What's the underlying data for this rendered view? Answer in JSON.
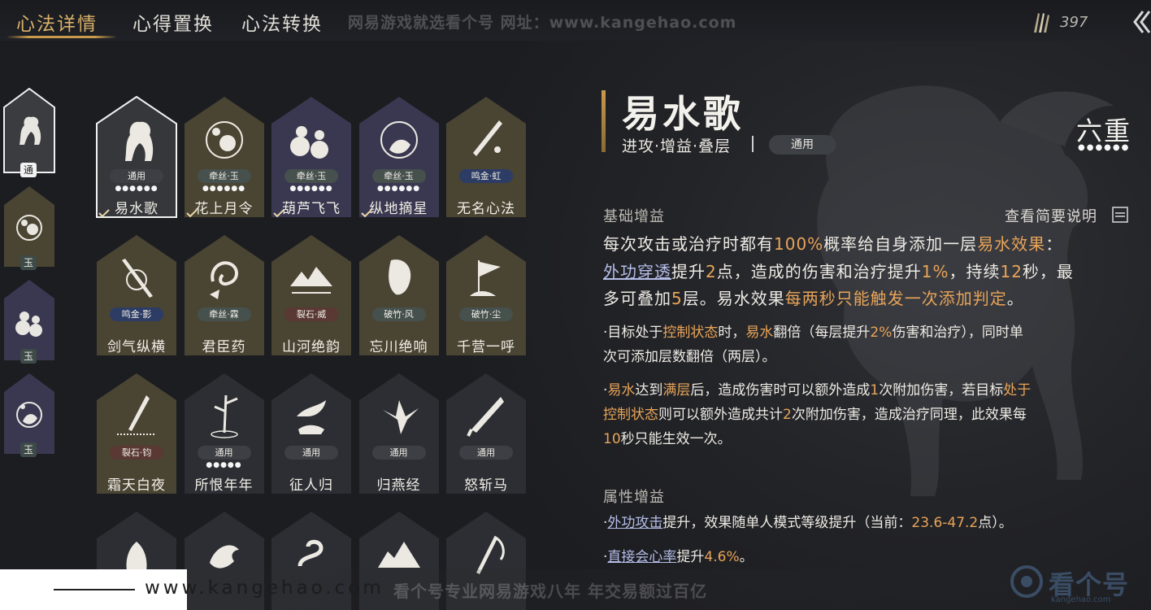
{
  "tabs": [
    {
      "label": "心法详情",
      "active": true
    },
    {
      "label": "心得置换",
      "active": false
    },
    {
      "label": "心法转换",
      "active": false
    }
  ],
  "watermark_top": "网易游戏就选看个号   网址：www.kangehao.com",
  "currency": {
    "icon": "feather-icon",
    "value": "397"
  },
  "left_rail": [
    {
      "icon": "horse-icon",
      "tag": "通",
      "selected": true
    },
    {
      "icon": "flower-icon",
      "tag": "玉",
      "selected": false
    },
    {
      "icon": "gourd-icon",
      "tag": "玉",
      "selected": false
    },
    {
      "icon": "star-circle-icon",
      "tag": "玉",
      "selected": false
    }
  ],
  "cards": [
    {
      "name": "易水歌",
      "tag": "通用",
      "tone": "white",
      "dots": "●●●●●●",
      "selected": true,
      "checked": true,
      "icon": "horse-icon"
    },
    {
      "name": "花上月令",
      "tag": "牵丝·玉",
      "tone": "gold",
      "dots": "●●●●●●",
      "selected": false,
      "checked": true,
      "icon": "flower-icon"
    },
    {
      "name": "葫芦飞飞",
      "tag": "牵丝·玉",
      "tone": "purple",
      "dots": "●●●●●●",
      "selected": false,
      "checked": true,
      "icon": "gourd-icon"
    },
    {
      "name": "纵地摘星",
      "tag": "牵丝·玉",
      "tone": "purple",
      "dots": "●●●●●●",
      "selected": false,
      "checked": true,
      "icon": "star-circle-icon"
    },
    {
      "name": "无名心法",
      "tag": "鸣金·虹",
      "tone": "gold",
      "dots": "",
      "selected": false,
      "checked": false,
      "icon": "sword-icon"
    },
    {
      "name": "剑气纵横",
      "tag": "鸣金·影",
      "tone": "gold",
      "dots": "",
      "selected": false,
      "checked": false,
      "icon": "swords-icon"
    },
    {
      "name": "君臣药",
      "tag": "牵丝·霖",
      "tone": "gold",
      "dots": "",
      "selected": false,
      "checked": false,
      "icon": "medicine-icon"
    },
    {
      "name": "山河绝韵",
      "tag": "裂石·威",
      "tone": "gold",
      "dots": "",
      "selected": false,
      "checked": false,
      "icon": "mountain-icon"
    },
    {
      "name": "忘川绝响",
      "tag": "破竹·风",
      "tone": "gold",
      "dots": "",
      "selected": false,
      "checked": false,
      "icon": "mask-icon"
    },
    {
      "name": "千营一呼",
      "tag": "破竹·尘",
      "tone": "gold",
      "dots": "",
      "selected": false,
      "checked": false,
      "icon": "flag-icon"
    },
    {
      "name": "霜天白夜",
      "tag": "裂石·钧",
      "tone": "gold",
      "dots": "",
      "selected": false,
      "checked": false,
      "icon": "blade-icon"
    },
    {
      "name": "所恨年年",
      "tag": "通用",
      "tone": "dark",
      "dots": "●●●●●",
      "selected": false,
      "checked": false,
      "icon": "bamboo-icon"
    },
    {
      "name": "征人归",
      "tag": "通用",
      "tone": "dark",
      "dots": "",
      "selected": false,
      "checked": false,
      "icon": "bird-hand-icon"
    },
    {
      "name": "归燕经",
      "tag": "通用",
      "tone": "dark",
      "dots": "",
      "selected": false,
      "checked": false,
      "icon": "swallow-icon"
    },
    {
      "name": "怒斩马",
      "tag": "通用",
      "tone": "dark",
      "dots": "",
      "selected": false,
      "checked": false,
      "icon": "broadsword-icon"
    },
    {
      "name": "",
      "tag": "",
      "tone": "dark",
      "dots": "",
      "selected": false,
      "checked": false,
      "icon": "beast-icon"
    },
    {
      "name": "",
      "tag": "",
      "tone": "dark",
      "dots": "",
      "selected": false,
      "checked": false,
      "icon": "dragon-icon"
    },
    {
      "name": "",
      "tag": "",
      "tone": "dark",
      "dots": "",
      "selected": false,
      "checked": false,
      "icon": "snake-icon"
    },
    {
      "name": "",
      "tag": "",
      "tone": "dark",
      "dots": "",
      "selected": false,
      "checked": false,
      "icon": "peaks-icon"
    },
    {
      "name": "",
      "tag": "",
      "tone": "dark",
      "dots": "",
      "selected": false,
      "checked": false,
      "icon": "scythe-icon"
    }
  ],
  "detail": {
    "title": "易水歌",
    "tags": "进攻·增益·叠层",
    "type_pill": "通用",
    "tier": "六重",
    "tier_dots": "●●●●●●",
    "section_basic": "基础增益",
    "summary_link": "查看简要说明",
    "basic": {
      "l1": [
        "每次攻击或治疗时都有",
        "100%",
        "概率给自身添加一层",
        "易水效果",
        "："
      ],
      "l2": [
        "外功穿透",
        "提升",
        "2",
        "点，造成的伤害和治疗提升",
        "1%",
        "，持续",
        "12",
        "秒，最"
      ],
      "l3": [
        "多可叠加",
        "5",
        "层。易水效果",
        "每两秒只能触发一次添加判定",
        "。"
      ]
    },
    "b1": {
      "l1": [
        "·目标处于",
        "控制状态",
        "时，",
        "易水",
        "翻倍（每层提升",
        "2%",
        "伤害和治疗），同时单"
      ],
      "l2": "次可添加层数翻倍（两层）。"
    },
    "b2": {
      "l1": [
        "·",
        "易水",
        "达到",
        "满层",
        "后，造成伤害时可以额外造成",
        "1",
        "次附加伤害，若目标",
        "处于"
      ],
      "l2": [
        "控制状态",
        "则可以额外造成共计",
        "2",
        "次附加伤害，造成治疗同理，此效果每"
      ],
      "l3": [
        "10",
        "秒只能生效一次。"
      ]
    },
    "section_attr": "属性增益",
    "a1": [
      "·",
      "外功攻击",
      "提升，效果随单人模式等级提升（当前：",
      "23.6-47.2",
      "点）。"
    ],
    "a2": [
      "·",
      "直接会心率",
      "提升",
      "4.6%",
      "。"
    ]
  },
  "watermark_bottom": {
    "url": "www.kangehao.com",
    "slogan": "看个号专业网易游戏八年   年交易额过百亿",
    "logo_text": "看个号",
    "logo_sub": "kangehao.com"
  }
}
